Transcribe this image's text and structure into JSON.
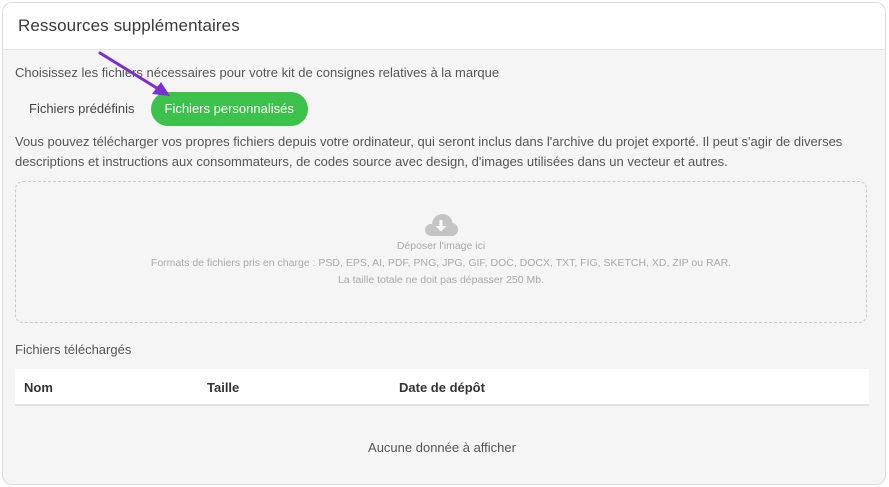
{
  "panel": {
    "title": "Ressources supplémentaires"
  },
  "subtitle": "Choisissez les fichiers nécessaires pour votre kit de consignes relatives à la marque",
  "tabs": [
    {
      "label": "Fichiers prédéfinis",
      "active": false
    },
    {
      "label": "Fichiers personnalisés",
      "active": true
    }
  ],
  "description": "Vous pouvez télécharger vos propres fichiers depuis votre ordinateur, qui seront inclus dans l'archive du projet exporté. Il peut s'agir de diverses descriptions et instructions aux consommateurs, de codes source avec design, d'images utilisées dans un vecteur et autres.",
  "dropzone": {
    "icon": "cloud-download-icon",
    "drop_text": "Déposer l'image ici",
    "formats_text": "Formats de fichiers pris en charge : PSD, EPS, AI, PDF, PNG, JPG, GIF, DOC, DOCX, TXT, FIG, SKETCH, XD, ZIP ou RAR.",
    "size_limit_text": "La taille totale ne doit pas dépasser 250 Mb."
  },
  "uploaded": {
    "label": "Fichiers téléchargés",
    "columns": [
      "Nom",
      "Taille",
      "Date de dépôt"
    ],
    "empty_text": "Aucune donnée à afficher"
  },
  "colors": {
    "accent_green": "#3cc24a",
    "annotation_arrow": "#7b2fd0"
  }
}
